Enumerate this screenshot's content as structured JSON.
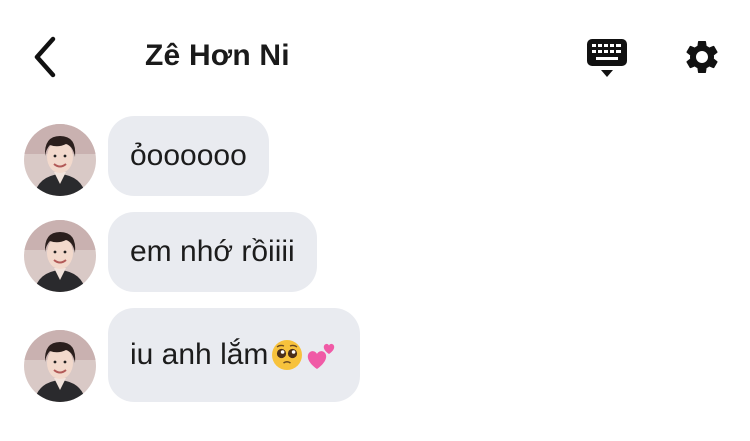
{
  "header": {
    "title": "Zê Hơn Ni",
    "back_icon": "chevron-left-icon",
    "keyboard_icon": "keyboard-icon",
    "settings_icon": "gear-icon"
  },
  "messages": [
    {
      "text": "ỏoooooo"
    },
    {
      "text": "em nhớ rồiiii"
    },
    {
      "text": "iu anh lắm",
      "emojis": [
        "pleading-face-emoji",
        "two-hearts-emoji"
      ]
    }
  ],
  "colors": {
    "bubble": "#e9ebf0",
    "text": "#1c1c1c",
    "background": "#ffffff"
  }
}
